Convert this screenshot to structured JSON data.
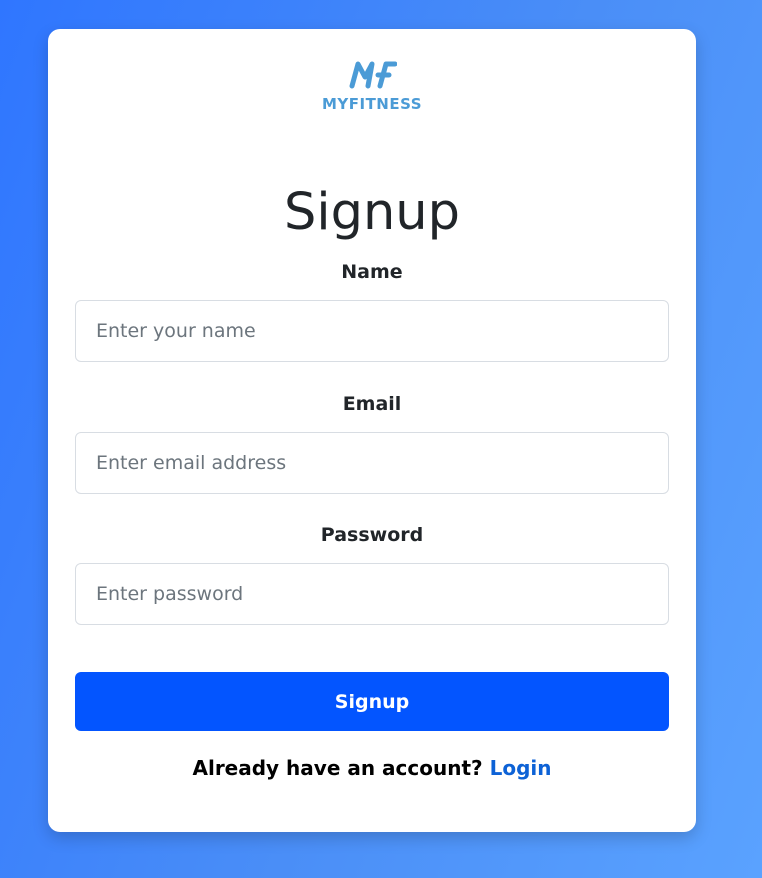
{
  "brand": {
    "logo_icon": "mf-logo-icon",
    "name": "MYFITNESS",
    "color": "#4b9bd6"
  },
  "form": {
    "title": "Signup",
    "fields": [
      {
        "label": "Name",
        "placeholder": "Enter your name",
        "value": ""
      },
      {
        "label": "Email",
        "placeholder": "Enter email address",
        "value": ""
      },
      {
        "label": "Password",
        "placeholder": "Enter password",
        "value": ""
      }
    ],
    "submit_label": "Signup",
    "submit_color": "#0355ff"
  },
  "footer": {
    "prompt": "Already have an account?",
    "link_label": "Login",
    "link_color": "#0d62d6"
  }
}
